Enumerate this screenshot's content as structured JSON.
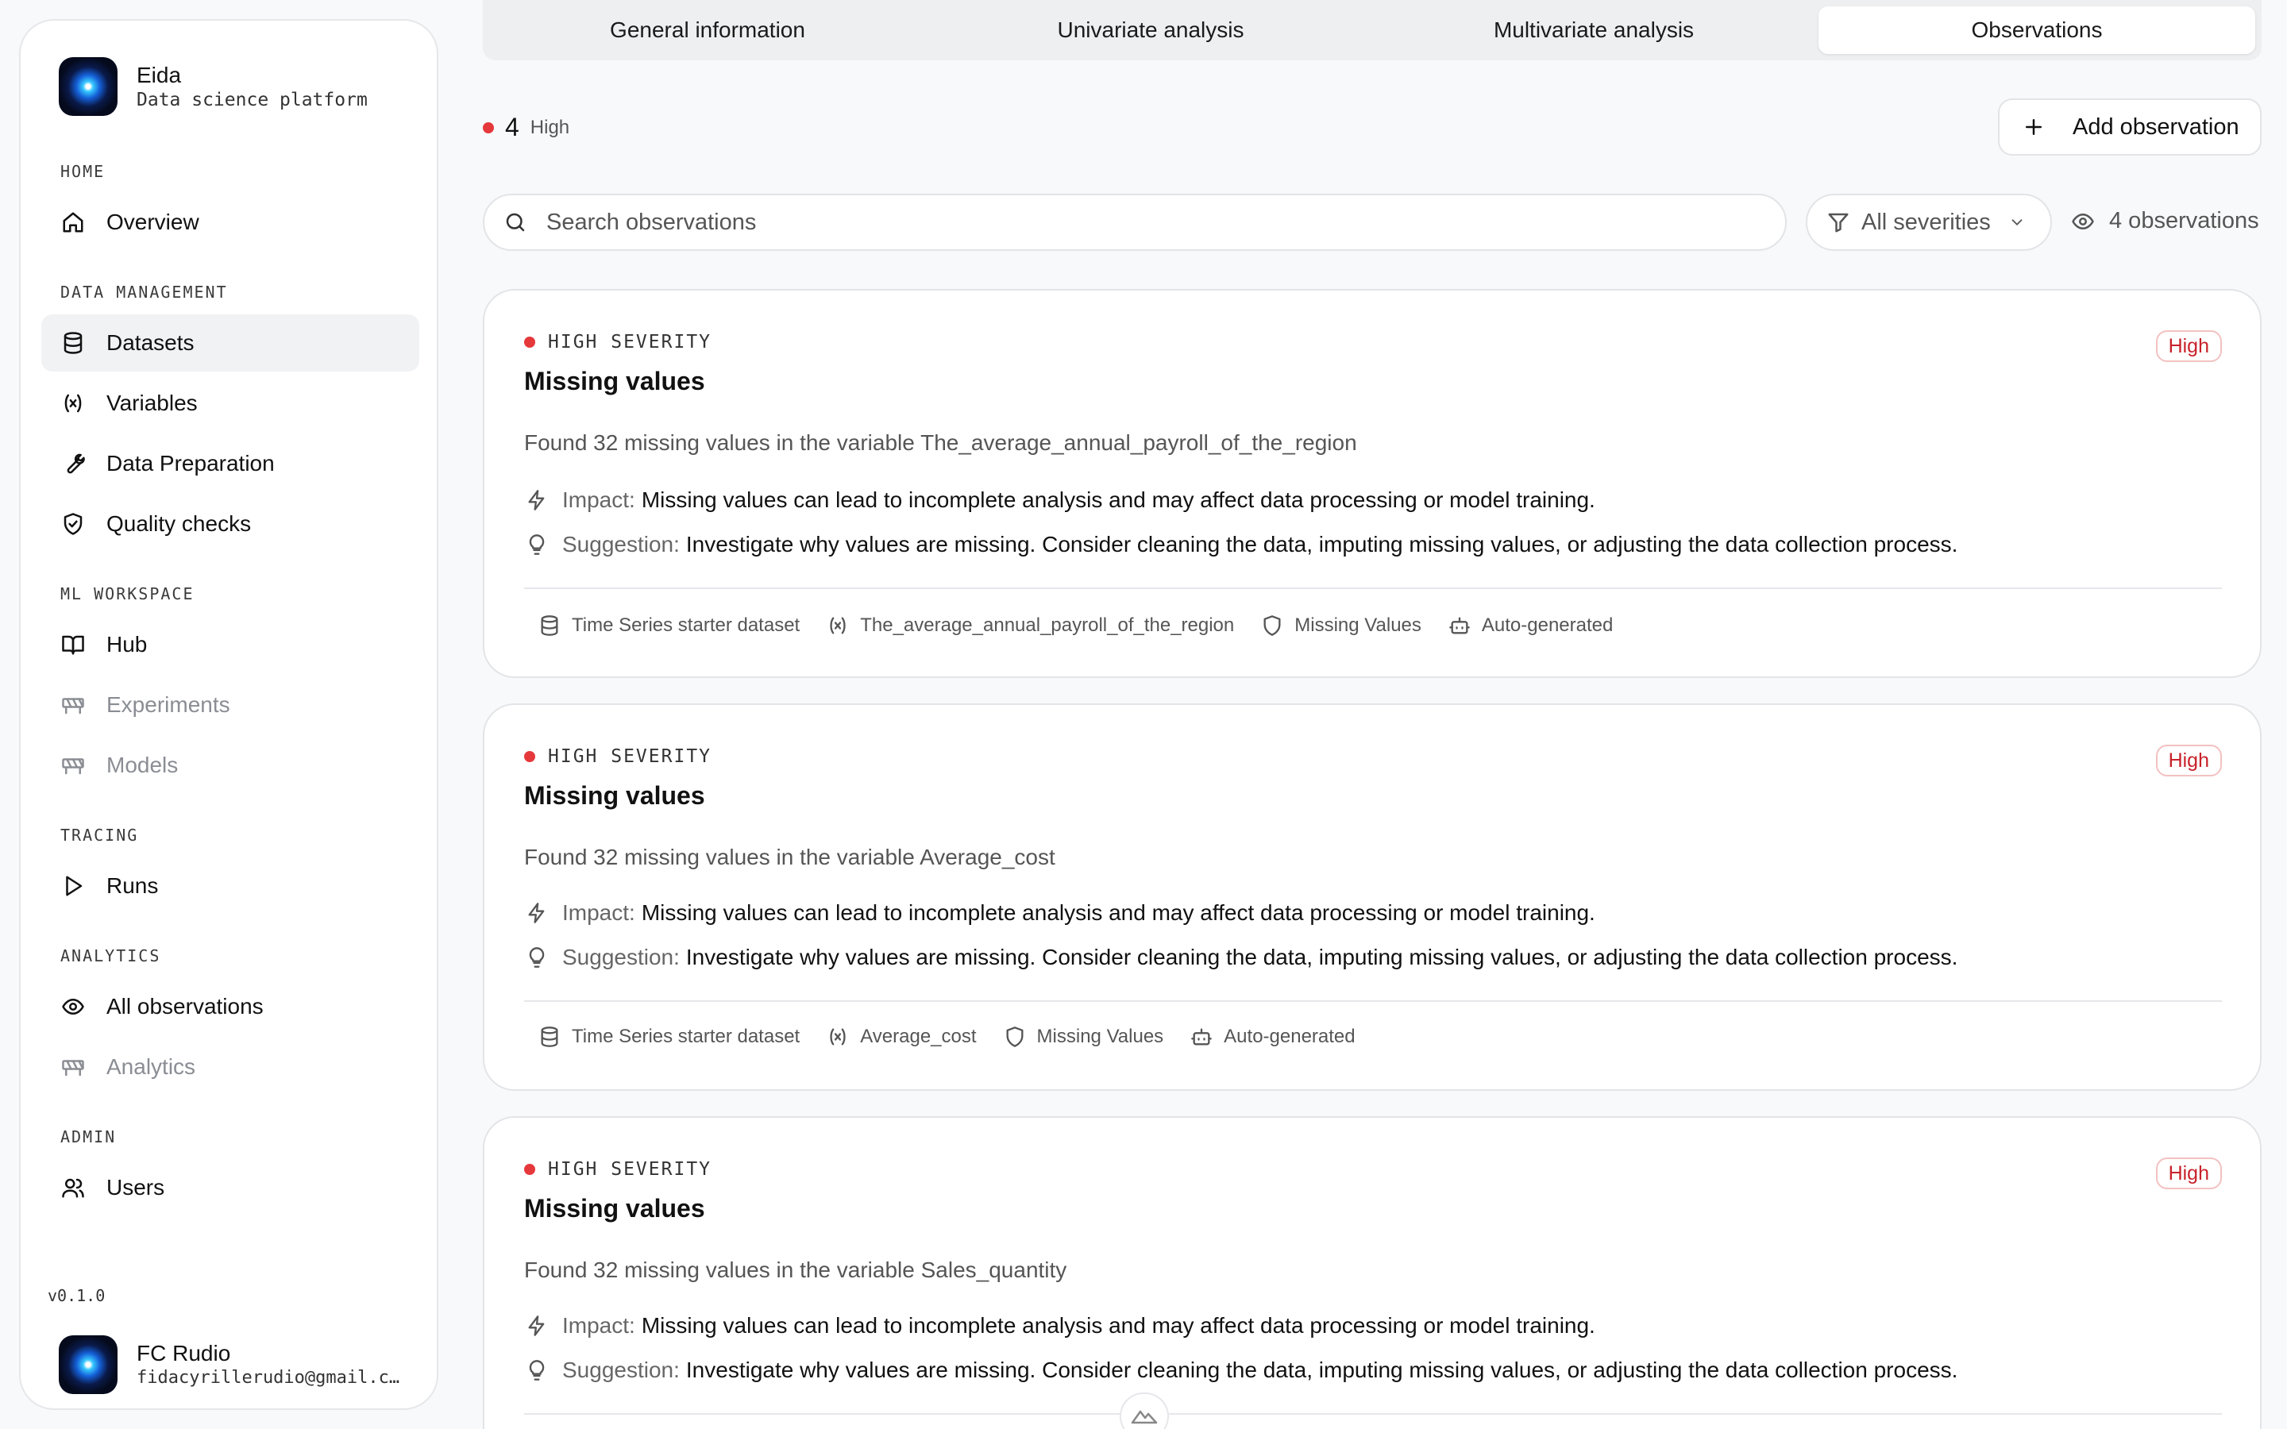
{
  "sidebar": {
    "brand_name": "Eida",
    "brand_sub": "Data science platform",
    "sections": {
      "home": "HOME",
      "data_management": "DATA MANAGEMENT",
      "ml_workspace": "ML WORKSPACE",
      "tracing": "TRACING",
      "analytics": "ANALYTICS",
      "admin": "ADMIN"
    },
    "items": {
      "overview": "Overview",
      "datasets": "Datasets",
      "variables": "Variables",
      "data_preparation": "Data Preparation",
      "quality_checks": "Quality checks",
      "hub": "Hub",
      "experiments": "Experiments",
      "models": "Models",
      "runs": "Runs",
      "all_observations": "All observations",
      "analytics": "Analytics",
      "users": "Users"
    },
    "active_item": "Datasets",
    "version": "v0.1.0",
    "user_name": "FC Rudio",
    "user_email": "fidacyrillerudio@gmail.com"
  },
  "tabs": [
    {
      "label": "General information"
    },
    {
      "label": "Univariate analysis"
    },
    {
      "label": "Multivariate analysis"
    },
    {
      "label": "Observations"
    }
  ],
  "active_tab": "Observations",
  "summary": {
    "count": "4",
    "severity": "High",
    "dot_color": "#e5383b"
  },
  "add_button": "Add observation",
  "search": {
    "placeholder": "Search observations",
    "value": ""
  },
  "filter": {
    "selected": "All severities"
  },
  "observation_count": "4 observations",
  "cards": [
    {
      "severity_label": "HIGH SEVERITY",
      "badge": "High",
      "title": "Missing values",
      "description": "Found 32 missing values in the variable The_average_annual_payroll_of_the_region",
      "impact_key": "Impact:",
      "impact": "Missing values can lead to incomplete analysis and may affect data processing or model training.",
      "suggestion_key": "Suggestion:",
      "suggestion": "Investigate why values are missing. Consider cleaning the data, imputing missing values, or adjusting the data collection process.",
      "dataset": "Time Series starter dataset",
      "variable": "The_average_annual_payroll_of_the_region",
      "check": "Missing Values",
      "source": "Auto-generated"
    },
    {
      "severity_label": "HIGH SEVERITY",
      "badge": "High",
      "title": "Missing values",
      "description": "Found 32 missing values in the variable Average_cost",
      "impact_key": "Impact:",
      "impact": "Missing values can lead to incomplete analysis and may affect data processing or model training.",
      "suggestion_key": "Suggestion:",
      "suggestion": "Investigate why values are missing. Consider cleaning the data, imputing missing values, or adjusting the data collection process.",
      "dataset": "Time Series starter dataset",
      "variable": "Average_cost",
      "check": "Missing Values",
      "source": "Auto-generated"
    },
    {
      "severity_label": "HIGH SEVERITY",
      "badge": "High",
      "title": "Missing values",
      "description": "Found 32 missing values in the variable Sales_quantity",
      "impact_key": "Impact:",
      "impact": "Missing values can lead to incomplete analysis and may affect data processing or model training.",
      "suggestion_key": "Suggestion:",
      "suggestion": "Investigate why values are missing. Consider cleaning the data, imputing missing values, or adjusting the data collection process."
    }
  ],
  "colors": {
    "accent_red": "#e5383b",
    "badge_text": "#c8222a",
    "muted": "#8a8d93"
  }
}
